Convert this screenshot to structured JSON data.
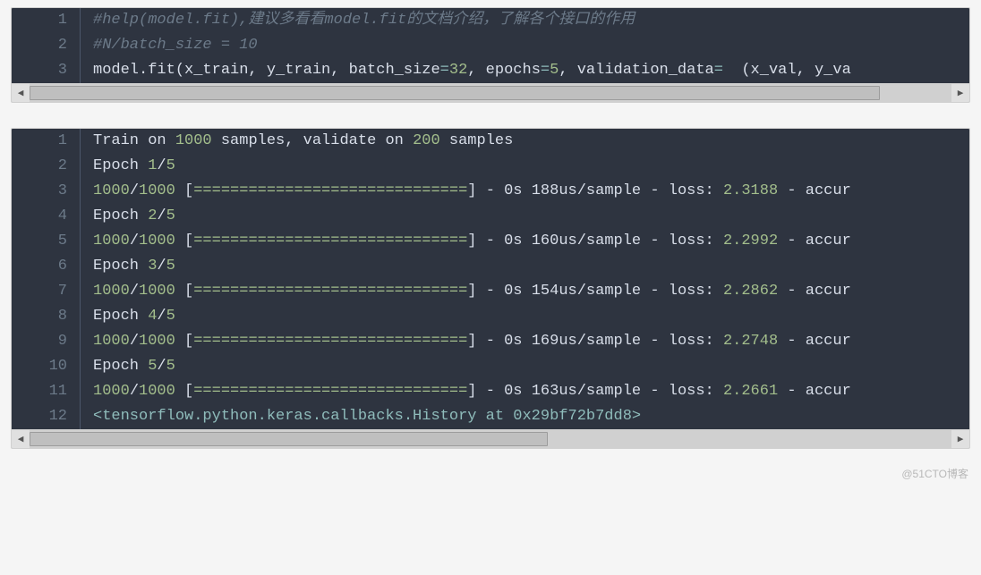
{
  "block1": {
    "lines": [
      {
        "n": 1,
        "tokens": [
          {
            "cls": "comment",
            "t": "#help(model.fit),建议多看看model.fit的文档介绍，了解各个接口的作用"
          }
        ]
      },
      {
        "n": 2,
        "tokens": [
          {
            "cls": "comment",
            "t": "#N/batch_size = 10"
          }
        ]
      },
      {
        "n": 3,
        "tokens": [
          {
            "cls": "ident",
            "t": "model.fit(x_train, y_train, batch_size"
          },
          {
            "cls": "eq",
            "t": "="
          },
          {
            "cls": "num",
            "t": "32"
          },
          {
            "cls": "ident",
            "t": ", epochs"
          },
          {
            "cls": "eq",
            "t": "="
          },
          {
            "cls": "num",
            "t": "5"
          },
          {
            "cls": "ident",
            "t": ", validation_data"
          },
          {
            "cls": "eq",
            "t": "="
          },
          {
            "cls": "ident",
            "t": "  (x_val, y_va"
          }
        ]
      }
    ],
    "scroll": {
      "left_pct": 0,
      "width_pct": 92
    }
  },
  "block2": {
    "lines": [
      {
        "n": 1,
        "tokens": [
          {
            "cls": "ident",
            "t": "Train on "
          },
          {
            "cls": "num",
            "t": "1000"
          },
          {
            "cls": "ident",
            "t": " samples, validate on "
          },
          {
            "cls": "num",
            "t": "200"
          },
          {
            "cls": "ident",
            "t": " samples"
          }
        ]
      },
      {
        "n": 2,
        "tokens": [
          {
            "cls": "ident",
            "t": "Epoch "
          },
          {
            "cls": "num",
            "t": "1"
          },
          {
            "cls": "op",
            "t": "/"
          },
          {
            "cls": "num",
            "t": "5"
          }
        ]
      },
      {
        "n": 3,
        "tokens": [
          {
            "cls": "num",
            "t": "1000"
          },
          {
            "cls": "op",
            "t": "/"
          },
          {
            "cls": "num",
            "t": "1000"
          },
          {
            "cls": "ident",
            "t": " ["
          },
          {
            "cls": "prog",
            "t": "=============================="
          },
          {
            "cls": "ident",
            "t": "] - 0s 188us"
          },
          {
            "cls": "op",
            "t": "/"
          },
          {
            "cls": "ident",
            "t": "sample - loss: "
          },
          {
            "cls": "num",
            "t": "2.3188"
          },
          {
            "cls": "ident",
            "t": " - accur"
          }
        ]
      },
      {
        "n": 4,
        "tokens": [
          {
            "cls": "ident",
            "t": "Epoch "
          },
          {
            "cls": "num",
            "t": "2"
          },
          {
            "cls": "op",
            "t": "/"
          },
          {
            "cls": "num",
            "t": "5"
          }
        ]
      },
      {
        "n": 5,
        "tokens": [
          {
            "cls": "num",
            "t": "1000"
          },
          {
            "cls": "op",
            "t": "/"
          },
          {
            "cls": "num",
            "t": "1000"
          },
          {
            "cls": "ident",
            "t": " ["
          },
          {
            "cls": "prog",
            "t": "=============================="
          },
          {
            "cls": "ident",
            "t": "] - 0s 160us"
          },
          {
            "cls": "op",
            "t": "/"
          },
          {
            "cls": "ident",
            "t": "sample - loss: "
          },
          {
            "cls": "num",
            "t": "2.2992"
          },
          {
            "cls": "ident",
            "t": " - accur"
          }
        ]
      },
      {
        "n": 6,
        "tokens": [
          {
            "cls": "ident",
            "t": "Epoch "
          },
          {
            "cls": "num",
            "t": "3"
          },
          {
            "cls": "op",
            "t": "/"
          },
          {
            "cls": "num",
            "t": "5"
          }
        ]
      },
      {
        "n": 7,
        "tokens": [
          {
            "cls": "num",
            "t": "1000"
          },
          {
            "cls": "op",
            "t": "/"
          },
          {
            "cls": "num",
            "t": "1000"
          },
          {
            "cls": "ident",
            "t": " ["
          },
          {
            "cls": "prog",
            "t": "=============================="
          },
          {
            "cls": "ident",
            "t": "] - 0s 154us"
          },
          {
            "cls": "op",
            "t": "/"
          },
          {
            "cls": "ident",
            "t": "sample - loss: "
          },
          {
            "cls": "num",
            "t": "2.2862"
          },
          {
            "cls": "ident",
            "t": " - accur"
          }
        ]
      },
      {
        "n": 8,
        "tokens": [
          {
            "cls": "ident",
            "t": "Epoch "
          },
          {
            "cls": "num",
            "t": "4"
          },
          {
            "cls": "op",
            "t": "/"
          },
          {
            "cls": "num",
            "t": "5"
          }
        ]
      },
      {
        "n": 9,
        "tokens": [
          {
            "cls": "num",
            "t": "1000"
          },
          {
            "cls": "op",
            "t": "/"
          },
          {
            "cls": "num",
            "t": "1000"
          },
          {
            "cls": "ident",
            "t": " ["
          },
          {
            "cls": "prog",
            "t": "=============================="
          },
          {
            "cls": "ident",
            "t": "] - 0s 169us"
          },
          {
            "cls": "op",
            "t": "/"
          },
          {
            "cls": "ident",
            "t": "sample - loss: "
          },
          {
            "cls": "num",
            "t": "2.2748"
          },
          {
            "cls": "ident",
            "t": " - accur"
          }
        ]
      },
      {
        "n": 10,
        "tokens": [
          {
            "cls": "ident",
            "t": "Epoch "
          },
          {
            "cls": "num",
            "t": "5"
          },
          {
            "cls": "op",
            "t": "/"
          },
          {
            "cls": "num",
            "t": "5"
          }
        ]
      },
      {
        "n": 11,
        "tokens": [
          {
            "cls": "num",
            "t": "1000"
          },
          {
            "cls": "op",
            "t": "/"
          },
          {
            "cls": "num",
            "t": "1000"
          },
          {
            "cls": "ident",
            "t": " ["
          },
          {
            "cls": "prog",
            "t": "=============================="
          },
          {
            "cls": "ident",
            "t": "] - 0s 163us"
          },
          {
            "cls": "op",
            "t": "/"
          },
          {
            "cls": "ident",
            "t": "sample - loss: "
          },
          {
            "cls": "num",
            "t": "2.2661"
          },
          {
            "cls": "ident",
            "t": " - accur"
          }
        ]
      },
      {
        "n": 12,
        "tokens": [
          {
            "cls": "str",
            "t": "<tensorflow.python.keras.callbacks.History at 0x29bf72b7dd8>"
          }
        ]
      }
    ],
    "scroll": {
      "left_pct": 0,
      "width_pct": 56
    }
  },
  "watermark": "@51CTO博客"
}
